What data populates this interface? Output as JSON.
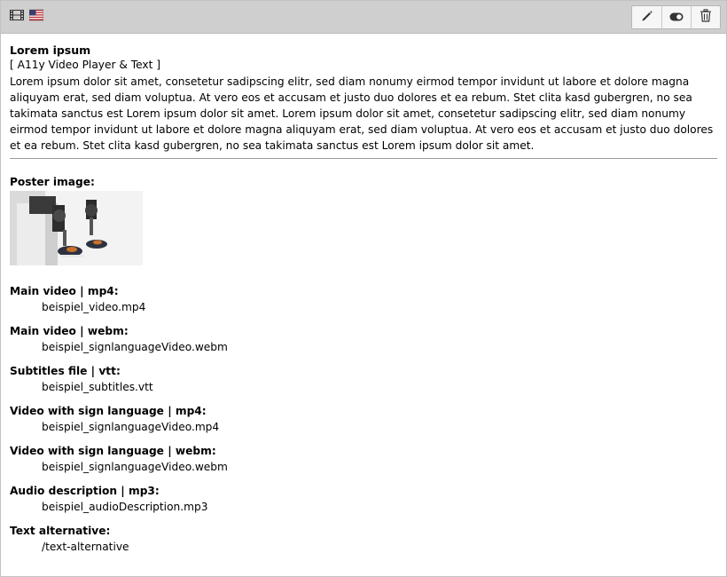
{
  "header": {
    "type_icon": "film-icon",
    "language_icon": "us-flag-icon",
    "actions": [
      {
        "icon": "pencil-icon"
      },
      {
        "icon": "toggle-icon"
      },
      {
        "icon": "trash-icon"
      }
    ]
  },
  "content": {
    "title": "Lorem ipsum",
    "subtitle": "[ A11y Video Player & Text ]",
    "body": "Lorem ipsum dolor sit amet, consetetur sadipscing elitr, sed diam nonumy eirmod tempor invidunt ut labore et dolore magna aliquyam erat, sed diam voluptua. At vero eos et accusam et justo duo dolores et ea rebum. Stet clita kasd gubergren, no sea takimata sanctus est Lorem ipsum dolor sit amet. Lorem ipsum dolor sit amet, consetetur sadipscing elitr, sed diam nonumy eirmod tempor invidunt ut labore et dolore magna aliquyam erat, sed diam voluptua. At vero eos et accusam et justo duo dolores et ea rebum. Stet clita kasd gubergren, no sea takimata sanctus est Lorem ipsum dolor sit amet."
  },
  "poster": {
    "label": "Poster image:"
  },
  "fields": [
    {
      "label": "Main video | mp4:",
      "value": "beispiel_video.mp4"
    },
    {
      "label": "Main video | webm:",
      "value": "beispiel_signlanguageVideo.webm"
    },
    {
      "label": "Subtitles file | vtt:",
      "value": "beispiel_subtitles.vtt"
    },
    {
      "label": "Video with sign language | mp4:",
      "value": "beispiel_signlanguageVideo.mp4"
    },
    {
      "label": "Video with sign language | webm:",
      "value": "beispiel_signlanguageVideo.webm"
    },
    {
      "label": "Audio description | mp3:",
      "value": "beispiel_audioDescription.mp3"
    },
    {
      "label": "Text alternative:",
      "value": "/text-alternative"
    }
  ]
}
